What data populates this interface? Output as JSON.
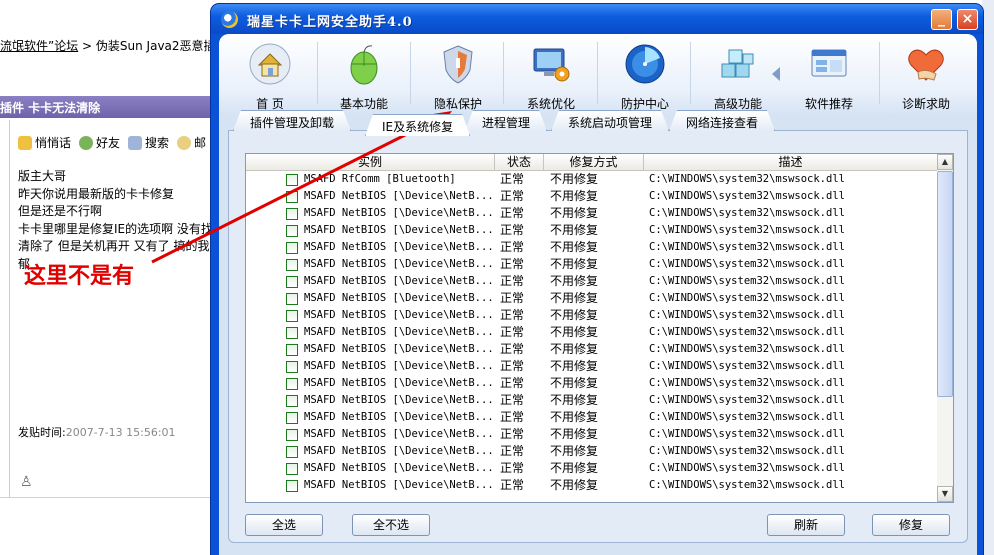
{
  "forum": {
    "breadcrumb_link": "流氓软件”论坛",
    "breadcrumb_rest": " > 伪装Sun Java2恶意插",
    "section_title": "插件 卡卡无法清除",
    "actions": [
      "悄悄话",
      "好友",
      "搜索",
      "邮"
    ],
    "post_lines": [
      "版主大哥",
      "昨天你说用最新版的卡卡修复",
      "但是还是不行啊",
      "卡卡里哪里是修复IE的选项啊 没有找",
      "清除了 但是关机再开  又有了 搞的我",
      "郁"
    ],
    "annotation": "这里不是有",
    "post_time_label": "发贴时间:",
    "post_time_value": "2007-7-13 15:56:01"
  },
  "window": {
    "title": "瑞星卡卡上网安全助手4.0",
    "min_label": "_",
    "close_label": "×"
  },
  "toolbar": [
    {
      "name": "home",
      "label": "首 页"
    },
    {
      "name": "basic",
      "label": "基本功能"
    },
    {
      "name": "privacy",
      "label": "隐私保护"
    },
    {
      "name": "optimize",
      "label": "系统优化"
    },
    {
      "name": "defense",
      "label": "防护中心"
    },
    {
      "name": "advanced",
      "label": "高级功能"
    },
    {
      "name": "recommend",
      "label": "软件推荐"
    },
    {
      "name": "help",
      "label": "诊断求助"
    }
  ],
  "tabs": [
    {
      "label": "插件管理及卸载",
      "active": false
    },
    {
      "label": "IE及系统修复",
      "active": true
    },
    {
      "label": "进程管理",
      "active": false
    },
    {
      "label": "系统启动项管理",
      "active": false
    },
    {
      "label": "网络连接查看",
      "active": false
    }
  ],
  "grid": {
    "columns": [
      "实例",
      "状态",
      "修复方式",
      "描述"
    ],
    "rows": [
      {
        "inst": "MSAFD RfComm [Bluetooth]",
        "status": "正常",
        "fix": "不用修复",
        "desc": "C:\\WINDOWS\\system32\\mswsock.dll"
      },
      {
        "inst": "MSAFD NetBIOS [\\Device\\NetB...",
        "status": "正常",
        "fix": "不用修复",
        "desc": "C:\\WINDOWS\\system32\\mswsock.dll"
      },
      {
        "inst": "MSAFD NetBIOS [\\Device\\NetB...",
        "status": "正常",
        "fix": "不用修复",
        "desc": "C:\\WINDOWS\\system32\\mswsock.dll"
      },
      {
        "inst": "MSAFD NetBIOS [\\Device\\NetB...",
        "status": "正常",
        "fix": "不用修复",
        "desc": "C:\\WINDOWS\\system32\\mswsock.dll"
      },
      {
        "inst": "MSAFD NetBIOS [\\Device\\NetB...",
        "status": "正常",
        "fix": "不用修复",
        "desc": "C:\\WINDOWS\\system32\\mswsock.dll"
      },
      {
        "inst": "MSAFD NetBIOS [\\Device\\NetB...",
        "status": "正常",
        "fix": "不用修复",
        "desc": "C:\\WINDOWS\\system32\\mswsock.dll"
      },
      {
        "inst": "MSAFD NetBIOS [\\Device\\NetB...",
        "status": "正常",
        "fix": "不用修复",
        "desc": "C:\\WINDOWS\\system32\\mswsock.dll"
      },
      {
        "inst": "MSAFD NetBIOS [\\Device\\NetB...",
        "status": "正常",
        "fix": "不用修复",
        "desc": "C:\\WINDOWS\\system32\\mswsock.dll"
      },
      {
        "inst": "MSAFD NetBIOS [\\Device\\NetB...",
        "status": "正常",
        "fix": "不用修复",
        "desc": "C:\\WINDOWS\\system32\\mswsock.dll"
      },
      {
        "inst": "MSAFD NetBIOS [\\Device\\NetB...",
        "status": "正常",
        "fix": "不用修复",
        "desc": "C:\\WINDOWS\\system32\\mswsock.dll"
      },
      {
        "inst": "MSAFD NetBIOS [\\Device\\NetB...",
        "status": "正常",
        "fix": "不用修复",
        "desc": "C:\\WINDOWS\\system32\\mswsock.dll"
      },
      {
        "inst": "MSAFD NetBIOS [\\Device\\NetB...",
        "status": "正常",
        "fix": "不用修复",
        "desc": "C:\\WINDOWS\\system32\\mswsock.dll"
      },
      {
        "inst": "MSAFD NetBIOS [\\Device\\NetB...",
        "status": "正常",
        "fix": "不用修复",
        "desc": "C:\\WINDOWS\\system32\\mswsock.dll"
      },
      {
        "inst": "MSAFD NetBIOS [\\Device\\NetB...",
        "status": "正常",
        "fix": "不用修复",
        "desc": "C:\\WINDOWS\\system32\\mswsock.dll"
      },
      {
        "inst": "MSAFD NetBIOS [\\Device\\NetB...",
        "status": "正常",
        "fix": "不用修复",
        "desc": "C:\\WINDOWS\\system32\\mswsock.dll"
      },
      {
        "inst": "MSAFD NetBIOS [\\Device\\NetB...",
        "status": "正常",
        "fix": "不用修复",
        "desc": "C:\\WINDOWS\\system32\\mswsock.dll"
      },
      {
        "inst": "MSAFD NetBIOS [\\Device\\NetB...",
        "status": "正常",
        "fix": "不用修复",
        "desc": "C:\\WINDOWS\\system32\\mswsock.dll"
      },
      {
        "inst": "MSAFD NetBIOS [\\Device\\NetB...",
        "status": "正常",
        "fix": "不用修复",
        "desc": "C:\\WINDOWS\\system32\\mswsock.dll"
      },
      {
        "inst": "MSAFD NetBIOS [\\Device\\NetB...",
        "status": "正常",
        "fix": "不用修复",
        "desc": "C:\\WINDOWS\\system32\\mswsock.dll"
      }
    ]
  },
  "buttons": {
    "select_all": "全选",
    "select_none": "全不选",
    "refresh": "刷新",
    "repair": "修复"
  },
  "colors": {
    "annotation_red": "#e00000",
    "xp_blue": "#0a52d6"
  }
}
